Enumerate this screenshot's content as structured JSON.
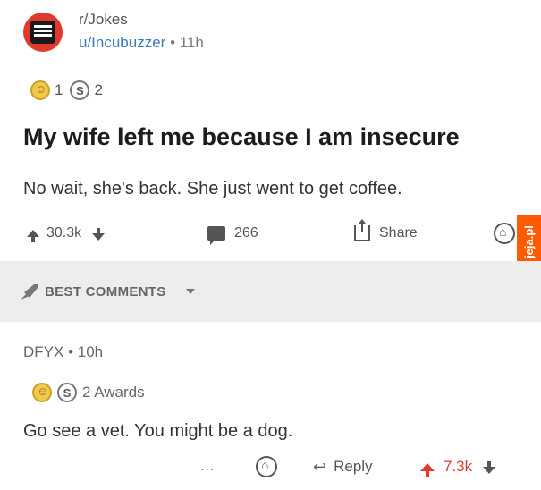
{
  "post": {
    "subreddit": "r/Jokes",
    "username": "u/Incubuzzer",
    "separator": " • ",
    "age": "11h",
    "awards": {
      "gold_count": "1",
      "silver_count": "2"
    },
    "title": "My wife left me because I am insecure",
    "body": "No wait, she's back. She just went to get coffee.",
    "actions": {
      "score": "30.3k",
      "comments": "266",
      "share_label": "Share"
    }
  },
  "watermark": {
    "text": "jeja.pl",
    "color": "#ff5a00"
  },
  "sort": {
    "label": "BEST COMMENTS"
  },
  "comment": {
    "author": "DFYX",
    "separator": " • ",
    "age": "10h",
    "awards_label": "2 Awards",
    "text": "Go see a vet. You might be a dog.",
    "actions": {
      "more": "...",
      "reply_label": "Reply",
      "score": "7.3k"
    }
  },
  "colors": {
    "accent": "#e03a2f",
    "link": "#3a7bbf",
    "bar": "#ededed"
  },
  "icons": [
    "subreddit-avatar-icon",
    "gold-award-icon",
    "silver-award-icon",
    "upvote-icon",
    "downvote-icon",
    "comment-icon",
    "share-icon",
    "give-award-icon",
    "sort-rocket-icon",
    "chevron-down-icon",
    "reply-icon"
  ]
}
